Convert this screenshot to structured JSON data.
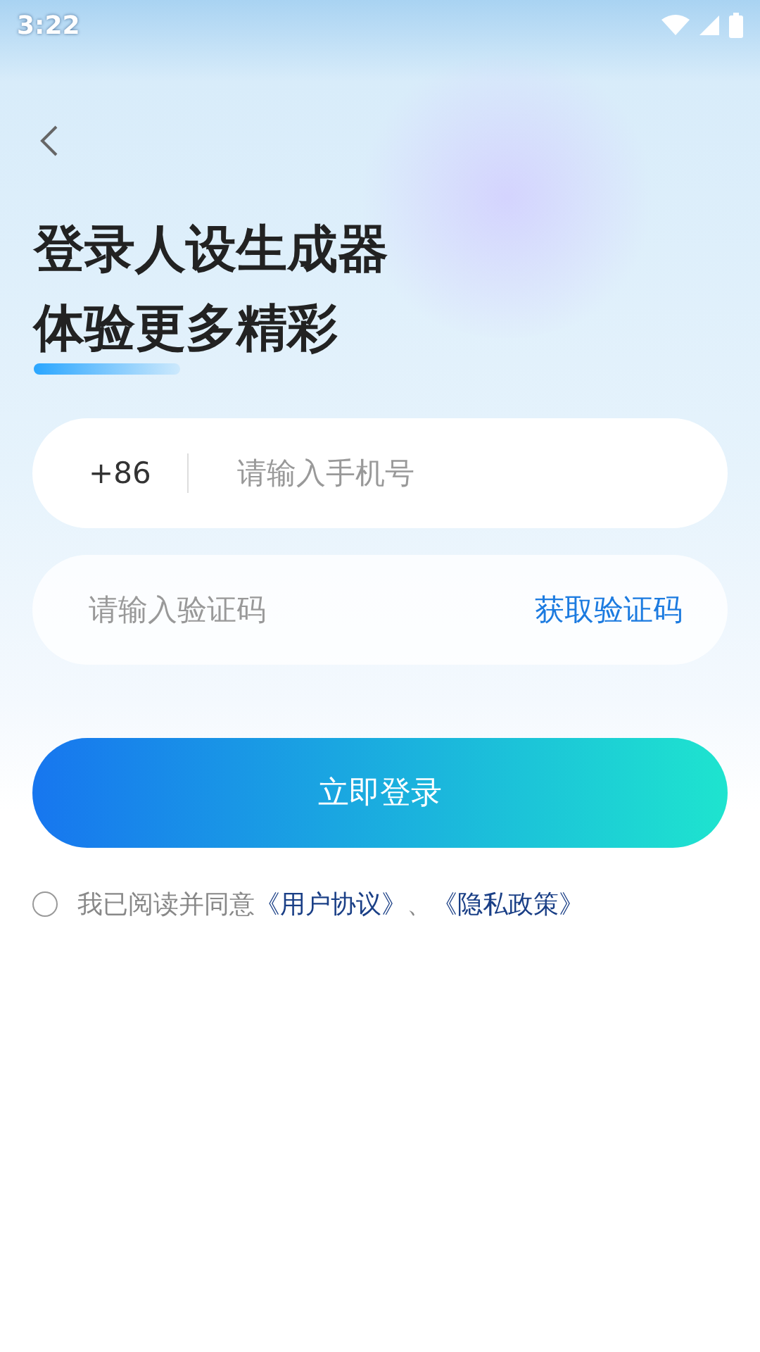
{
  "status_bar": {
    "time": "3:22"
  },
  "title_lines": [
    "登录人设生成器",
    "体验更多精彩"
  ],
  "phone": {
    "country_code": "+86",
    "placeholder": "请输入手机号"
  },
  "code": {
    "placeholder": "请输入验证码",
    "action": "获取验证码"
  },
  "login_button": "立即登录",
  "agreement": {
    "checked": false,
    "prefix": "我已阅读并同意",
    "links": [
      "《用户协议》",
      "《隐私政策》"
    ],
    "separator": "、"
  }
}
